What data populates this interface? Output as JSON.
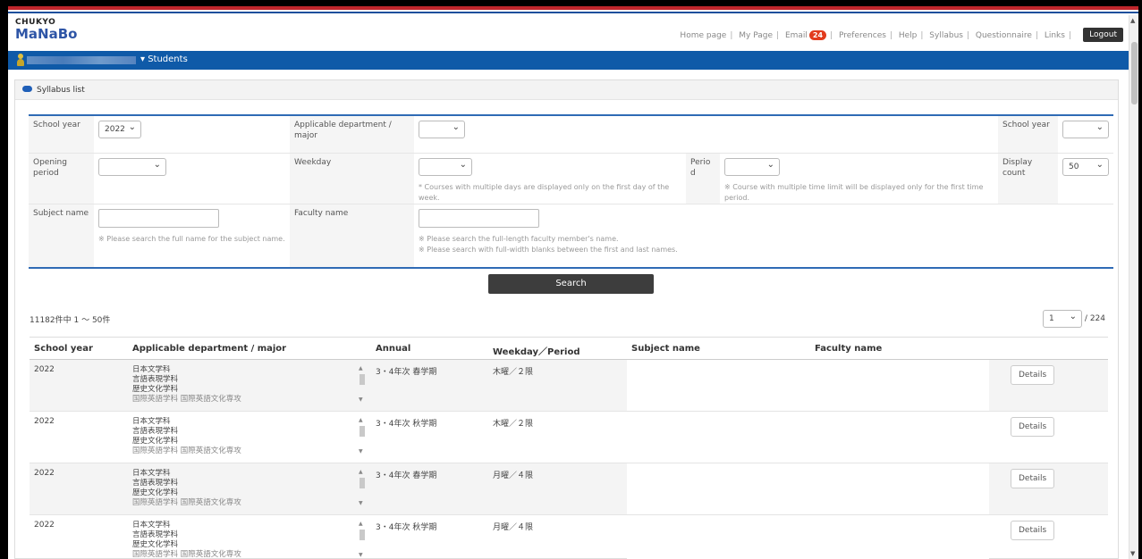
{
  "header": {
    "logo_top": "CHUKYO",
    "logo_main": "MaNaBo",
    "nav": [
      "Home page",
      "My Page",
      "Email",
      "Preferences",
      "Help",
      "Syllabus",
      "Questionnaire",
      "Links"
    ],
    "email_badge": "24",
    "logout_label": "Logout"
  },
  "bluebar": {
    "students_label": "▾ Students"
  },
  "section": {
    "title": "Syllabus list"
  },
  "form": {
    "school_year_label": "School year",
    "school_year_value": "2022",
    "department_label": "Applicable department / major",
    "school_year2_label": "School year",
    "opening_period_label": "Opening period",
    "weekday_label": "Weekday",
    "weekday_note": "* Courses with multiple days are displayed only on the first day of the week.",
    "period_label": "Perio d",
    "period_note": "※ Course with multiple time limit will be displayed only for the first time period.",
    "display_count_label": "Display count",
    "display_count_value": "50",
    "subject_label": "Subject name",
    "subject_note": "※ Please search the full name for the subject name.",
    "faculty_label": "Faculty name",
    "faculty_note1": "※ Please search the full-length faculty member's name.",
    "faculty_note2": "※ Please search with full-width blanks between the first and last names.",
    "search_label": "Search"
  },
  "results": {
    "count_text": "11182件中 1 ～ 50件",
    "page_value": "1",
    "page_total": "/ 224"
  },
  "table": {
    "headers": [
      "School year",
      "Applicable department / major",
      "Annual",
      "Weekday／Period",
      "Subject name",
      "Faculty name"
    ],
    "details_label": "Details",
    "rows": [
      {
        "year": "2022",
        "dept1": "日本文学科",
        "dept2": "言語表現学科",
        "dept3": "歴史文化学科",
        "dept4": "国際英語学科 国際英語文化専攻",
        "annual": "3・4年次 春学期",
        "weekday": "木曜／２限"
      },
      {
        "year": "2022",
        "dept1": "日本文学科",
        "dept2": "言語表現学科",
        "dept3": "歴史文化学科",
        "dept4": "国際英語学科 国際英語文化専攻",
        "annual": "3・4年次 秋学期",
        "weekday": "木曜／２限"
      },
      {
        "year": "2022",
        "dept1": "日本文学科",
        "dept2": "言語表現学科",
        "dept3": "歴史文化学科",
        "dept4": "国際英語学科 国際英語文化専攻",
        "annual": "3・4年次 春学期",
        "weekday": "月曜／４限"
      },
      {
        "year": "2022",
        "dept1": "日本文学科",
        "dept2": "言語表現学科",
        "dept3": "歴史文化学科",
        "dept4": "国際英語学科 国際英語文化専攻",
        "annual": "3・4年次 秋学期",
        "weekday": "月曜／４限"
      }
    ]
  }
}
